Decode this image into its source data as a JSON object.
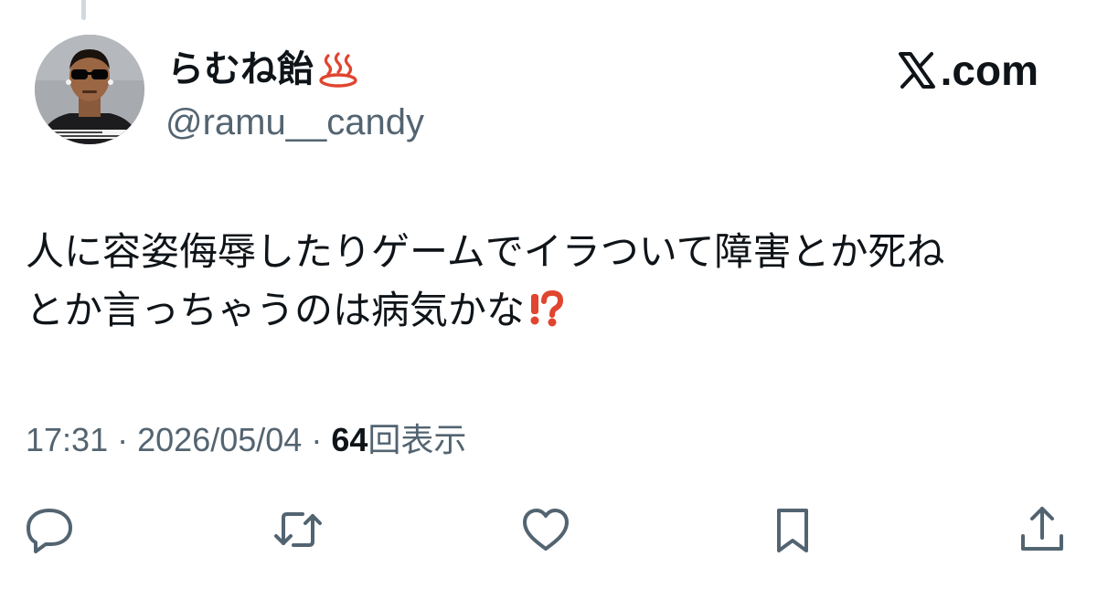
{
  "user": {
    "display_name": "らむね飴",
    "name_emoji": "hot-springs",
    "handle": "@ramu__candy"
  },
  "brand": {
    "logo": "x-logo",
    "domain": ".com"
  },
  "tweet": {
    "lines": [
      "人に容姿侮辱したりゲームでイラついて障害とか死ね",
      "とか言っちゃうのは病気かな"
    ],
    "trailing_emoji": "exclamation-question-mark"
  },
  "meta": {
    "time": "17:31",
    "separator": "·",
    "date": "2026/05/04",
    "views_count": "64",
    "views_label": "回表示"
  },
  "actions": {
    "icons": [
      "reply-icon",
      "retweet-icon",
      "like-icon",
      "bookmark-icon",
      "share-icon"
    ]
  },
  "colors": {
    "text": "#0f1419",
    "secondary": "#536471",
    "emoji_red": "#e0452f",
    "thread_line": "#cfd9de"
  }
}
